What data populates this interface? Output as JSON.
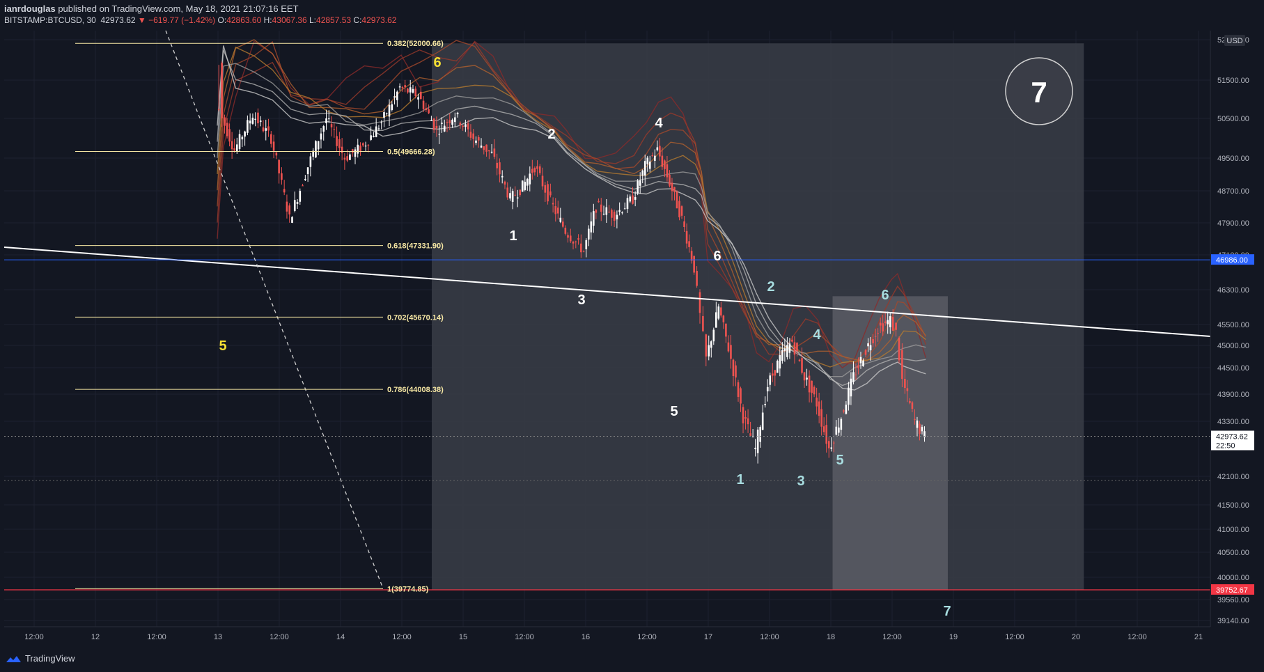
{
  "header": {
    "author": "ianrdouglas",
    "published_text": "published on TradingView.com, May 18, 2021 21:07:16 EET",
    "symbol": "BITSTAMP:BTCUSD, 30",
    "price": "42973.62",
    "change": "▼ −619.77 (−1.42%)",
    "o_label": "O:",
    "o_value": "42863.60",
    "h_label": "H:",
    "h_value": "43067.36",
    "l_label": "L:",
    "l_value": "42857.53",
    "c_label": "C:",
    "c_value": "42973.62"
  },
  "footer": {
    "brand": "TradingView"
  },
  "colors": {
    "background": "#131722",
    "fib": "#f5e6a3",
    "up": "#ffffff",
    "down": "#ef5350",
    "wave_yellow": "#f5e033",
    "wave_teal": "#a8dde0"
  },
  "chart_data": {
    "type": "candlestick",
    "currency_label": "USD",
    "x_ticks": [
      "12:00",
      "12",
      "12:00",
      "13",
      "12:00",
      "14",
      "12:00",
      "15",
      "12:00",
      "16",
      "12:00",
      "17",
      "12:00",
      "18",
      "12:00",
      "19",
      "12:00",
      "20",
      "12:00",
      "21"
    ],
    "y_ticks": [
      "52000.00",
      "51500.00",
      "50500.00",
      "49500.00",
      "48700.00",
      "47900.00",
      "47100.00",
      "46300.00",
      "45500.00",
      "45000.00",
      "44500.00",
      "43900.00",
      "43300.00",
      "42100.00",
      "41500.00",
      "41000.00",
      "40500.00",
      "40000.00",
      "39560.00",
      "39140.00"
    ],
    "price_tags": [
      {
        "label": "46986.00",
        "color": "#2962ff"
      },
      {
        "label": "42973.62",
        "sub": "22:50",
        "color": "#ffffff"
      },
      {
        "label": "39752.67",
        "color": "#f23645"
      }
    ],
    "fib_levels": [
      {
        "ratio": "0.382",
        "price": "52000.66",
        "text": "0.382(52000.66)"
      },
      {
        "ratio": "0.5",
        "price": "49666.28",
        "text": "0.5(49666.28)"
      },
      {
        "ratio": "0.618",
        "price": "47331.90",
        "text": "0.618(47331.90)"
      },
      {
        "ratio": "0.702",
        "price": "45670.14",
        "text": "0.702(45670.14)"
      },
      {
        "ratio": "0.786",
        "price": "44008.38",
        "text": "0.786(44008.38)"
      },
      {
        "ratio": "1",
        "price": "39774.85",
        "text": "1(39774.85)"
      }
    ],
    "wave_labels": [
      {
        "text": "6",
        "color": "yellow"
      },
      {
        "text": "5",
        "color": "yellow"
      },
      {
        "text": "1",
        "color": "white"
      },
      {
        "text": "2",
        "color": "white"
      },
      {
        "text": "3",
        "color": "white"
      },
      {
        "text": "4",
        "color": "white"
      },
      {
        "text": "5",
        "color": "white"
      },
      {
        "text": "6",
        "color": "white"
      },
      {
        "text": "1",
        "color": "teal"
      },
      {
        "text": "2",
        "color": "teal"
      },
      {
        "text": "3",
        "color": "teal"
      },
      {
        "text": "4",
        "color": "teal"
      },
      {
        "text": "5",
        "color": "teal"
      },
      {
        "text": "6",
        "color": "teal"
      },
      {
        "text": "7",
        "color": "teal"
      }
    ],
    "circle_label": "7",
    "price_path": [
      [
        13.0,
        53000
      ],
      [
        13.05,
        50500
      ],
      [
        13.15,
        49700
      ],
      [
        13.3,
        50600
      ],
      [
        13.45,
        50000
      ],
      [
        13.6,
        48000
      ],
      [
        13.75,
        49300
      ],
      [
        13.9,
        50500
      ],
      [
        14.05,
        49500
      ],
      [
        14.2,
        49800
      ],
      [
        14.35,
        50400
      ],
      [
        14.5,
        51300
      ],
      [
        14.65,
        51100
      ],
      [
        14.8,
        50200
      ],
      [
        14.95,
        50600
      ],
      [
        15.1,
        50000
      ],
      [
        15.25,
        49600
      ],
      [
        15.4,
        48500
      ],
      [
        15.5,
        48800
      ],
      [
        15.6,
        49300
      ],
      [
        15.75,
        48300
      ],
      [
        15.85,
        47700
      ],
      [
        16.0,
        47200
      ],
      [
        16.1,
        48300
      ],
      [
        16.25,
        48100
      ],
      [
        16.4,
        48500
      ],
      [
        16.5,
        49300
      ],
      [
        16.6,
        49700
      ],
      [
        16.7,
        48900
      ],
      [
        16.8,
        48000
      ],
      [
        16.9,
        46800
      ],
      [
        16.95,
        45700
      ],
      [
        17.0,
        44700
      ],
      [
        17.1,
        45900
      ],
      [
        17.2,
        44700
      ],
      [
        17.3,
        43400
      ],
      [
        17.4,
        42700
      ],
      [
        17.5,
        44100
      ],
      [
        17.6,
        44700
      ],
      [
        17.7,
        45100
      ],
      [
        17.8,
        44300
      ],
      [
        17.9,
        43700
      ],
      [
        18.0,
        42700
      ],
      [
        18.1,
        43400
      ],
      [
        18.2,
        44300
      ],
      [
        18.3,
        44900
      ],
      [
        18.4,
        45400
      ],
      [
        18.5,
        45600
      ],
      [
        18.55,
        45300
      ],
      [
        18.6,
        44200
      ],
      [
        18.7,
        43300
      ],
      [
        18.78,
        42974
      ]
    ]
  }
}
